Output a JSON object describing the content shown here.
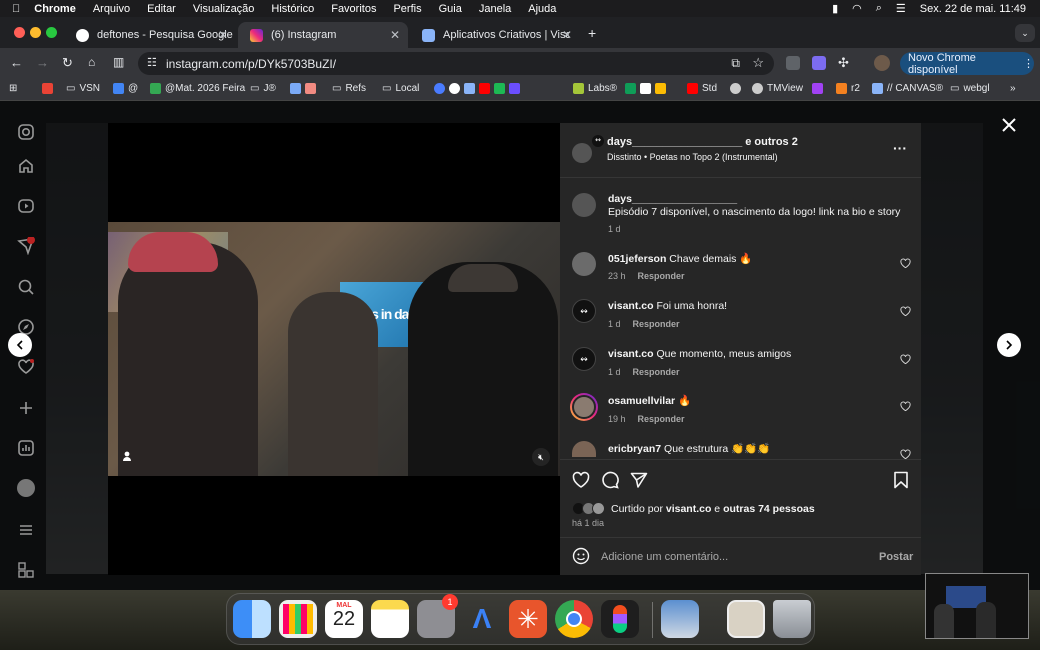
{
  "menubar": {
    "app": "Chrome",
    "items": [
      "Arquivo",
      "Editar",
      "Visualização",
      "Histórico",
      "Favoritos",
      "Perfis",
      "Guia",
      "Janela",
      "Ajuda"
    ],
    "datetime": "Sex. 22 de mai.  11:49"
  },
  "tabs": [
    {
      "title": "deftones - Pesquisa Google"
    },
    {
      "title": "(6) Instagram"
    },
    {
      "title": "Aplicativos Criativos | Visant"
    }
  ],
  "toolbar": {
    "url": "instagram.com/p/DYk5703BuZI/",
    "update_label": "Novo Chrome disponível"
  },
  "bookmarks": [
    "VSN",
    "@",
    "@Mat. 2026 Feira",
    "J®",
    "Refs",
    "Local",
    "Labs®",
    "Std",
    "TMView",
    "r2",
    "// CANVAS®",
    "webgl"
  ],
  "post": {
    "author": "days__________________",
    "coauthors": " e outros 2",
    "subtitle": "Disstinto  •  Poetas no Topo 2 (Instrumental)",
    "caption_author": "days__________________",
    "caption": "Episódio 7 disponível, o nascimento da logo! link na bio e story",
    "caption_time": "1 d",
    "likes_prefix": "Curtido por ",
    "likes_user": "visant.co",
    "likes_mid": " e ",
    "likes_rest": "outras 74 pessoas",
    "posted": "há 1 dia",
    "comment_placeholder": "Adicione um comentário...",
    "post_button": "Postar"
  },
  "comments": [
    {
      "user": "051jeferson",
      "text": "Chave demais 🔥",
      "time": "23 h",
      "reply": "Responder"
    },
    {
      "user": "visant.co",
      "text": "Foi uma honra!",
      "time": "1 d",
      "reply": "Responder"
    },
    {
      "user": "visant.co",
      "text": "Que momento, meus amigos",
      "time": "1 d",
      "reply": "Responder"
    },
    {
      "user": "osamuellvilar",
      "text": "🔥",
      "time": "19 h",
      "reply": "Responder"
    },
    {
      "user": "ericbryan7",
      "text": "Que estrutura 👏👏👏",
      "time": "",
      "reply": ""
    }
  ],
  "video": {
    "overlay_text": "days in days"
  },
  "dock": {
    "calendar_month": "MAL",
    "calendar_day": "22",
    "settings_badge": "1"
  },
  "icons": [
    "apple-icon",
    "close-icon",
    "chevron-left-icon",
    "chevron-right-icon",
    "heart-icon",
    "comment-icon",
    "share-icon",
    "bookmark-icon",
    "emoji-icon",
    "more-icon",
    "mute-icon",
    "user-tag-icon"
  ]
}
